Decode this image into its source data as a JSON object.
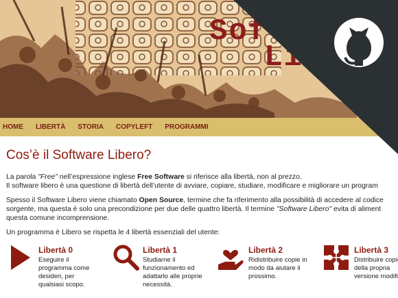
{
  "header": {
    "title_line1": "Soft",
    "title_line2": "Li"
  },
  "nav": {
    "items": [
      "HOME",
      "LIBERTÀ",
      "STORIA",
      "COPYLEFT",
      "PROGRAMMI"
    ]
  },
  "main": {
    "title": "Cos’è il Software Libero?",
    "p1": {
      "a": "La parola ",
      "b": "\"Free\"",
      "c": " nell’espressione inglese ",
      "d": "Free Software",
      "e": " si riferisce alla libertà, non al prezzo.",
      "line2": "Il software libero è una questione di libertà dell’utente di avviare, copiare, studiare, modificare e migliorare un program"
    },
    "p2": {
      "a": "Spesso il Software Libero viene chiamato ",
      "b": "Open Source",
      "c": ", termine che fa riferimento alla possibilità di accedere al codice",
      "line2a": "sorgente, ma questa è solo una precondizione per due delle quattro libertà. Il termine ",
      "line2b": "\"Software Libero\"",
      "line2c": " evita di aliment",
      "line3": "questa comune incomprensione."
    },
    "p3": "Un programma è Libero se rispetta le 4 libertà essenziali del utente:"
  },
  "freedoms": [
    {
      "title": "Libertà 0",
      "desc": "Eseguire il programma come desideri, per qualsiasi scopo.",
      "icon": "play-icon"
    },
    {
      "title": "Libertà 1",
      "desc": "Studiarne il funzionamento ed adattarlo alle proprie necessità.",
      "icon": "magnifier-icon"
    },
    {
      "title": "Libertà 2",
      "desc": "Ridistribuire copie in modo da aiutare il prossimo.",
      "icon": "heart-hand-icon"
    },
    {
      "title": "Libertà 3",
      "desc": "Distribuire copie della propria versione modificata.",
      "icon": "puzzle-icon"
    }
  ],
  "colors": {
    "accent": "#8e1b10",
    "nav_bg": "#d9be6d",
    "corner": "#2b3033"
  }
}
